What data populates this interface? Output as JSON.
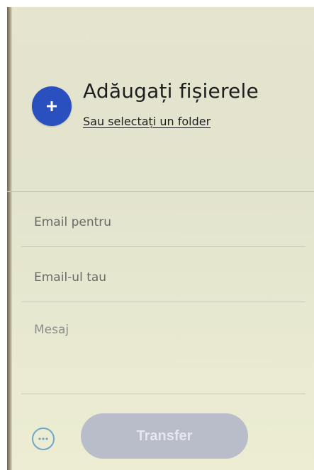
{
  "upload": {
    "title": "Adăugați fișierele",
    "folder_link": "Sau selectați un folder",
    "add_icon": "plus-icon"
  },
  "form": {
    "email_to": "Email pentru",
    "email_from": "Email-ul tau",
    "message": "Mesaj"
  },
  "footer": {
    "more_icon": "more-options-icon",
    "transfer_label": "Transfer"
  },
  "colors": {
    "accent": "#2a4fbf",
    "button_disabled": "#b9bcc9",
    "more_outline": "#6fa7c8"
  }
}
